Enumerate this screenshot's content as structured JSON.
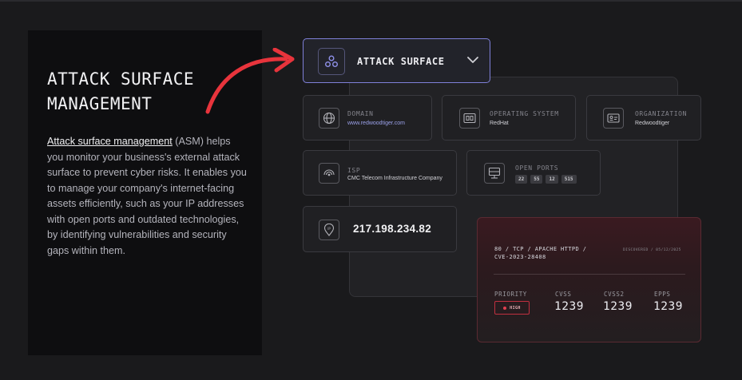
{
  "intro": {
    "heading_line1": "ATTACK SURFACE",
    "heading_line2": "MANAGEMENT",
    "link_text": "Attack surface management",
    "description_rest": " (ASM) helps you monitor your business's external attack surface to prevent cyber risks. It enables you to manage your company's internet-facing assets efficiently, such as your IP addresses with open ports and outdated technologies, by identifying vulnerabilities and security gaps within them."
  },
  "attack_card": {
    "title": "ATTACK SURFACE",
    "icon": "hub-icon",
    "accent": "#7f80d8"
  },
  "domain": {
    "label": "DOMAIN",
    "value": "www.redwoodtiger.com",
    "icon": "globe-icon",
    "value_color": "#9aa0e8"
  },
  "os": {
    "label": "OPERATING SYSTEM",
    "value": "RedHat",
    "icon": "os-icon"
  },
  "org": {
    "label": "ORGANIZATION",
    "value": "Redwoodtiger",
    "icon": "id-card-icon"
  },
  "isp": {
    "label": "ISP",
    "value": "CMC Telecom Infrastructure Company",
    "icon": "signal-icon"
  },
  "ports": {
    "label": "OPEN PORTS",
    "values": [
      "22",
      "55",
      "12",
      "515"
    ],
    "icon": "server-icon"
  },
  "ip": {
    "value": "217.198.234.82",
    "icon": "ip-pin-icon"
  },
  "cve": {
    "title_line1": "80 / TCP / APACHE HTTPD /",
    "title_line2": "CVE-2023-28408",
    "discovered": "DISCOVERED / 05/12/2025",
    "priority_label": "PRIORITY",
    "priority_value": "HIGH",
    "cvss_label": "CVSS",
    "cvss_value": "1239",
    "cvss2_label": "CVSS2",
    "cvss2_value": "1239",
    "epps_label": "EPPS",
    "epps_value": "1239",
    "priority_color": "#e04050"
  }
}
